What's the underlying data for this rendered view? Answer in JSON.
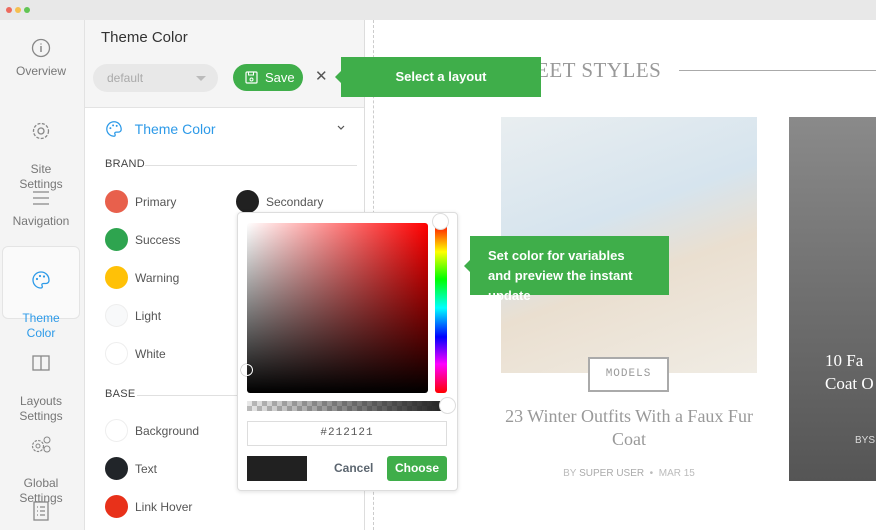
{
  "window": {
    "dot_colors": [
      "#ed6a5e",
      "#f5bf4f",
      "#62c554"
    ]
  },
  "sidebar": {
    "items": [
      {
        "label": "Overview",
        "icon": "info-icon"
      },
      {
        "label": "Site\nSettings",
        "icon": "gear-icon"
      },
      {
        "label": "Navigation",
        "icon": "menu-icon"
      },
      {
        "label": "Theme\nColor",
        "icon": "palette-icon",
        "active": true
      },
      {
        "label": "Layouts\nSettings",
        "icon": "layout-icon"
      },
      {
        "label": "Global\nSettings",
        "icon": "gears-icon"
      },
      {
        "label": "",
        "icon": "list-icon"
      }
    ]
  },
  "panel": {
    "title": "Theme Color",
    "layout_select": "default",
    "save_label": "Save",
    "section_title": "Theme Color",
    "brand_label": "BRAND",
    "base_label": "BASE",
    "brand": [
      {
        "name": "Primary",
        "color": "#e8604c"
      },
      {
        "name": "Secondary",
        "color": "#212121"
      },
      {
        "name": "Success",
        "color": "#2ea44f"
      },
      {
        "name": "Warning",
        "color": "#ffc107"
      },
      {
        "name": "Light",
        "color": "#f8f9fa"
      },
      {
        "name": "White",
        "color": "#ffffff"
      }
    ],
    "base": [
      {
        "name": "Background",
        "color": "#ffffff"
      },
      {
        "name": "Text",
        "color": "#212529"
      },
      {
        "name": "Link Hover",
        "color": "#e8311a"
      }
    ]
  },
  "picker": {
    "hex": "#212121",
    "cancel": "Cancel",
    "choose": "Choose",
    "hue": "#ff0000"
  },
  "tooltips": {
    "layout": "Select a layout",
    "color": "Set color for variables and preview the instant update"
  },
  "preview": {
    "heading": "EET STYLES",
    "card1": {
      "category": "MODELS",
      "title": "23 Winter Outfits With a Faux Fur Coat",
      "by": "BY",
      "author": "SUPER USER",
      "date": "MAR 15"
    },
    "card2": {
      "title": "10 Fa\nCoat O",
      "by": "BY",
      "author": "S"
    }
  },
  "colors": {
    "accent": "#2d9ae8",
    "green": "#3fae4a"
  }
}
